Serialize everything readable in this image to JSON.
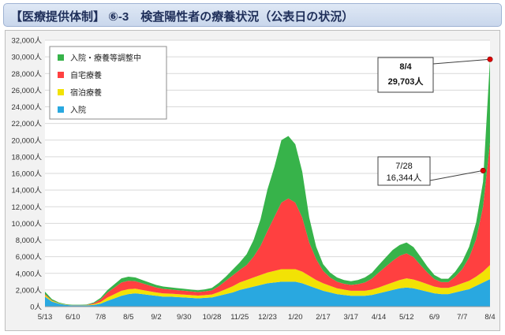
{
  "header": {
    "title": "【医療提供体制】 ⑥-3　検査陽性者の療養状況（公表日の状況）"
  },
  "chart_data": {
    "type": "area",
    "stacked": true,
    "title": "",
    "xlabel": "",
    "ylabel": "",
    "unit_suffix": "人",
    "ylim": [
      0,
      32000
    ],
    "ytick_step": 2000,
    "grid": true,
    "legend_position": "top-left",
    "x_start": "2020-05-13",
    "x_end": "2021-08-04",
    "xticks": [
      "5/13",
      "6/10",
      "7/8",
      "8/5",
      "9/2",
      "9/30",
      "10/28",
      "11/25",
      "12/23",
      "1/20",
      "2/17",
      "3/17",
      "4/14",
      "5/12",
      "6/9",
      "7/7",
      "8/4"
    ],
    "dates": [
      "2020-05-13",
      "2020-05-20",
      "2020-05-27",
      "2020-06-03",
      "2020-06-10",
      "2020-06-17",
      "2020-06-24",
      "2020-07-01",
      "2020-07-08",
      "2020-07-15",
      "2020-07-22",
      "2020-07-29",
      "2020-08-05",
      "2020-08-12",
      "2020-08-19",
      "2020-08-26",
      "2020-09-02",
      "2020-09-09",
      "2020-09-16",
      "2020-09-23",
      "2020-09-30",
      "2020-10-07",
      "2020-10-14",
      "2020-10-21",
      "2020-10-28",
      "2020-11-04",
      "2020-11-11",
      "2020-11-18",
      "2020-11-25",
      "2020-12-02",
      "2020-12-09",
      "2020-12-16",
      "2020-12-23",
      "2020-12-30",
      "2021-01-06",
      "2021-01-13",
      "2021-01-20",
      "2021-01-27",
      "2021-02-03",
      "2021-02-10",
      "2021-02-17",
      "2021-02-24",
      "2021-03-03",
      "2021-03-10",
      "2021-03-17",
      "2021-03-24",
      "2021-03-31",
      "2021-04-07",
      "2021-04-14",
      "2021-04-21",
      "2021-04-28",
      "2021-05-05",
      "2021-05-12",
      "2021-05-19",
      "2021-05-26",
      "2021-06-02",
      "2021-06-09",
      "2021-06-16",
      "2021-06-23",
      "2021-06-30",
      "2021-07-07",
      "2021-07-14",
      "2021-07-21",
      "2021-07-28",
      "2021-08-04"
    ],
    "series": [
      {
        "name": "入院",
        "color": "#29a8e0",
        "values": [
          1200,
          600,
          350,
          200,
          150,
          150,
          150,
          200,
          350,
          700,
          1000,
          1300,
          1500,
          1600,
          1500,
          1400,
          1300,
          1200,
          1200,
          1150,
          1100,
          1050,
          1000,
          1050,
          1100,
          1300,
          1500,
          1700,
          2000,
          2200,
          2400,
          2600,
          2800,
          2900,
          3000,
          3000,
          3000,
          2800,
          2500,
          2200,
          1900,
          1700,
          1500,
          1400,
          1300,
          1300,
          1300,
          1400,
          1600,
          1800,
          2000,
          2200,
          2300,
          2200,
          2000,
          1800,
          1600,
          1500,
          1500,
          1700,
          1900,
          2100,
          2500,
          2900,
          3300
        ]
      },
      {
        "name": "宿泊療養",
        "color": "#f2e205",
        "values": [
          200,
          100,
          50,
          30,
          30,
          30,
          40,
          100,
          200,
          400,
          500,
          600,
          600,
          550,
          500,
          450,
          400,
          380,
          360,
          350,
          340,
          330,
          320,
          330,
          350,
          450,
          600,
          750,
          900,
          1000,
          1100,
          1200,
          1300,
          1400,
          1500,
          1500,
          1500,
          1400,
          1200,
          1000,
          900,
          800,
          700,
          650,
          600,
          600,
          600,
          650,
          700,
          800,
          900,
          1000,
          1100,
          1050,
          1000,
          900,
          800,
          750,
          750,
          800,
          900,
          1000,
          1100,
          1300,
          1700
        ]
      },
      {
        "name": "自宅療養",
        "color": "#ff4040",
        "values": [
          100,
          50,
          20,
          10,
          10,
          10,
          20,
          100,
          300,
          600,
          800,
          1000,
          1000,
          900,
          800,
          700,
          600,
          550,
          500,
          480,
          460,
          440,
          420,
          450,
          500,
          700,
          1000,
          1300,
          1500,
          1800,
          2500,
          3500,
          5000,
          6500,
          8000,
          8500,
          8000,
          6500,
          4000,
          2500,
          1500,
          1000,
          800,
          700,
          700,
          800,
          1000,
          1300,
          1800,
          2200,
          2600,
          2900,
          3000,
          2700,
          2000,
          1400,
          900,
          700,
          700,
          1100,
          1700,
          2800,
          4500,
          7800,
          14700
        ]
      },
      {
        "name": "入院・療養等調整中",
        "color": "#37b34a",
        "values": [
          300,
          150,
          80,
          50,
          40,
          40,
          50,
          100,
          200,
          300,
          400,
          500,
          500,
          450,
          400,
          350,
          300,
          280,
          260,
          250,
          240,
          230,
          220,
          240,
          300,
          400,
          500,
          700,
          900,
          1300,
          2000,
          3200,
          5000,
          6000,
          7500,
          7500,
          7000,
          5500,
          3000,
          1500,
          800,
          600,
          500,
          450,
          450,
          500,
          600,
          700,
          900,
          1100,
          1300,
          1300,
          1300,
          1200,
          1000,
          700,
          500,
          400,
          400,
          600,
          900,
          1300,
          2000,
          3000,
          10000
        ]
      }
    ],
    "annotations": [
      {
        "date": "2021-07-28",
        "label": "7/28",
        "value_label": "16,344人",
        "value": 16344
      },
      {
        "date": "2021-08-04",
        "label": "8/4",
        "value_label": "29,703人",
        "value": 29703
      }
    ]
  }
}
